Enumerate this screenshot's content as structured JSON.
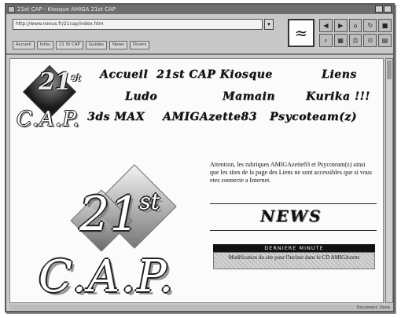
{
  "window": {
    "title": "21st CAP - Kiosque AMIGA 21st CAP"
  },
  "toolbar": {
    "url": "http://www.nexus.fr/21cap/index.htm",
    "bookmarks": [
      "Accueil",
      "Infos",
      "21 St CAP",
      "Guides",
      "News",
      "Divers"
    ]
  },
  "nav": {
    "accueil": "Accueil",
    "cap_kiosque": "21st CAP Kiosque",
    "liens": "Liens",
    "ludo": "Ludo",
    "mamain": "Mamain",
    "kurika": "Kurika !!!",
    "max": "3ds MAX",
    "amigazette": "AMIGAzette83",
    "psycoteam": "Psycoteam(z)"
  },
  "logo": {
    "small_num": "21",
    "small_sup": "st",
    "small_cap": "C.A.P.",
    "big_num": "21",
    "big_sup": "st",
    "big_cap": "C.A.P."
  },
  "notice_text": "Attention, les rubriques AMIGAzette83 et Psycoteam(z) ainsi que les sites de la page des Liens ne sont accessibles que si vous etes connecte a Internet.",
  "news": {
    "title": "NEWS",
    "header": "DERNIERE MINUTE",
    "body": "Modification du site pour l'inclure dans le CD AMIGAzette"
  },
  "status": {
    "text": "Document: Done"
  }
}
